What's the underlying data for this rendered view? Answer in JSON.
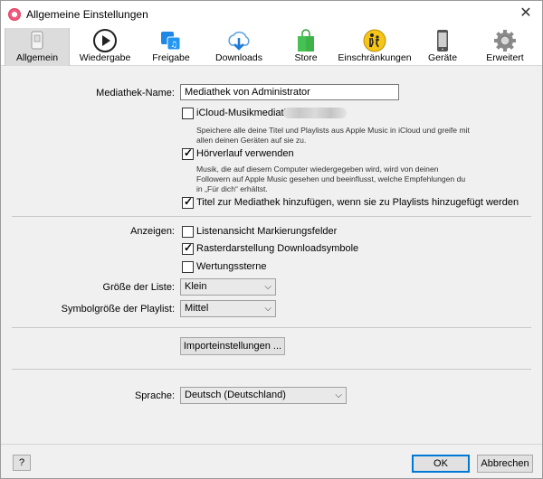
{
  "window": {
    "title": "Allgemeine Einstellungen"
  },
  "toolbar": {
    "items": [
      {
        "label": "Allgemein",
        "icon": "switch-icon"
      },
      {
        "label": "Wiedergabe",
        "icon": "play-icon"
      },
      {
        "label": "Freigabe",
        "icon": "share-icon"
      },
      {
        "label": "Downloads",
        "icon": "download-cloud-icon"
      },
      {
        "label": "Store",
        "icon": "store-bag-icon"
      },
      {
        "label": "Einschränkungen",
        "icon": "parental-icon"
      },
      {
        "label": "Geräte",
        "icon": "device-icon"
      },
      {
        "label": "Erweitert",
        "icon": "gear-icon"
      }
    ]
  },
  "library": {
    "name_label": "Mediathek-Name:",
    "name_value": "Mediathek von Administrator",
    "icloud_label": "iCloud-Musikmediathek",
    "icloud_desc": "Speichere alle deine Titel und Playlists aus Apple Music in iCloud und greife mit allen deinen Geräten auf sie zu.",
    "history_label": "Hörverlauf verwenden",
    "history_desc": "Musik, die auf diesem Computer wiedergegeben wird, wird von deinen Followern auf Apple Music gesehen und beeinflusst, welche Empfehlungen du in „Für dich“ erhältst.",
    "add_to_library_label": "Titel zur Mediathek hinzufügen, wenn sie zu Playlists hinzugefügt werden"
  },
  "display": {
    "show_label": "Anzeigen:",
    "list_checkboxes_label": "Listenansicht Markierungsfelder",
    "grid_download_label": "Rasterdarstellung Downloadsymbole",
    "stars_label": "Wertungssterne",
    "list_size_label": "Größe der Liste:",
    "list_size_value": "Klein",
    "playlist_icon_label": "Symbolgröße der Playlist:",
    "playlist_icon_value": "Mittel"
  },
  "import": {
    "button_label": "Importeinstellungen ..."
  },
  "language": {
    "label": "Sprache:",
    "value": "Deutsch (Deutschland)"
  },
  "footer": {
    "help_label": "?",
    "ok_label": "OK",
    "cancel_label": "Abbrechen"
  }
}
